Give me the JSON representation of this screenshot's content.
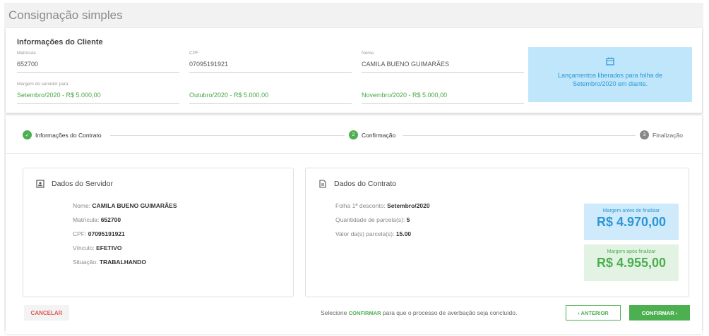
{
  "page": {
    "title": "Consignação simples"
  },
  "client": {
    "title": "Informações do Cliente",
    "matricula_label": "Matrícula",
    "matricula_value": "652700",
    "cpf_label": "CPF",
    "cpf_value": "07095191921",
    "nome_label": "Nome",
    "nome_value": "CAMILA BUENO GUIMARÃES",
    "margem_label": "Margem do servidor para",
    "margem_1": "Setembro/2020 - R$ 5.000,00",
    "margem_2": "Outubro/2020 - R$ 5.000,00",
    "margem_3": "Novembro/2020 - R$ 5.000,00",
    "info_line1": "Lançamentos liberados para folha de",
    "info_line2": "Setembro/2020 em diante."
  },
  "stepper": {
    "step1": "Informações do Contrato",
    "step2_num": "2",
    "step2": "Confirmação",
    "step3_num": "3",
    "step3": "Finalização"
  },
  "servidor": {
    "title": "Dados do Servidor",
    "nome_label": "Nome:",
    "nome_value": "CAMILA BUENO GUIMARÃES",
    "matricula_label": "Matrícula:",
    "matricula_value": "652700",
    "cpf_label": "CPF:",
    "cpf_value": "07095191921",
    "vinculo_label": "Vínculo:",
    "vinculo_value": "EFETIVO",
    "situacao_label": "Situação:",
    "situacao_value": "TRABALHANDO"
  },
  "contrato": {
    "title": "Dados do Contrato",
    "folha_label": "Folha 1ª desconto:",
    "folha_value": "Setembro/2020",
    "qtd_label": "Quantidade de parcela(s):",
    "qtd_value": "5",
    "valor_label": "Valor da(s) parcela(s):",
    "valor_value": "15.00",
    "margem_antes_label": "Margem antes de finalizar",
    "margem_antes_value": "R$ 4.970,00",
    "margem_apos_label": "Margem após finalizar",
    "margem_apos_value": "R$ 4.955,00"
  },
  "footer": {
    "cancel": "CANCELAR",
    "text_pre": "Selecione",
    "text_hl": "CONFIRMAR",
    "text_post": "para que o processo de averbação seja concluído.",
    "prev": "‹ ANTERIOR",
    "next": "CONFIRMAR ›"
  },
  "colors": {
    "accent_green": "#4caf50",
    "accent_blue": "#2b97d6",
    "danger": "#e05a5a"
  },
  "icons": [
    "calendar-icon",
    "check-icon",
    "id-card-icon",
    "document-icon"
  ]
}
